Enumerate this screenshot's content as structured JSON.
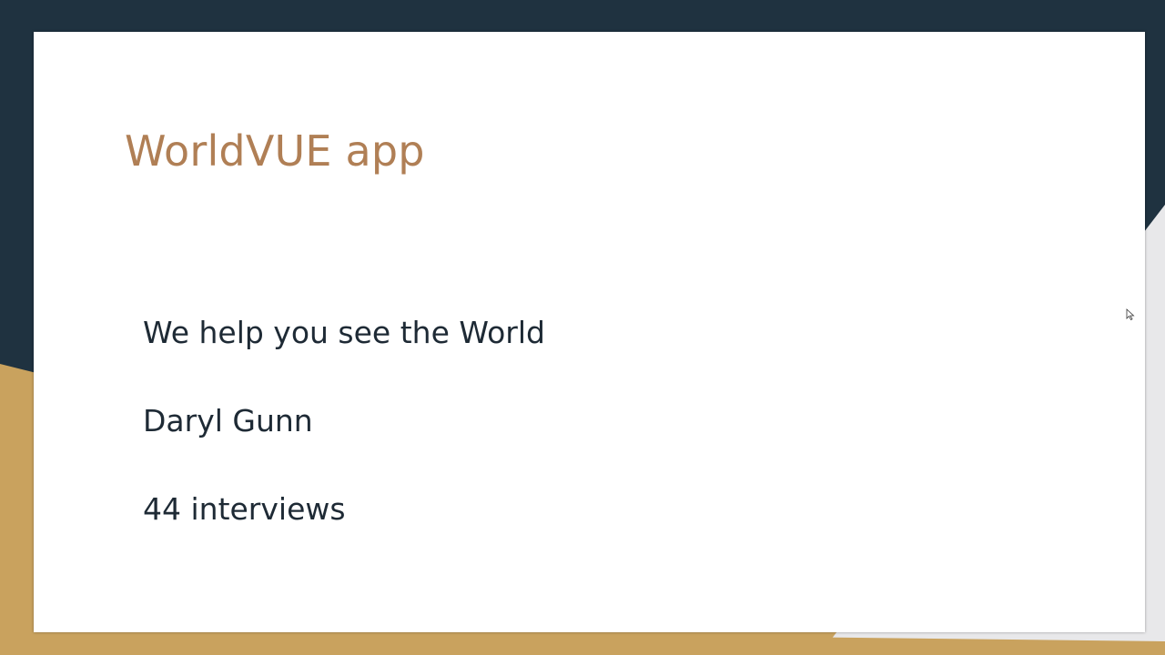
{
  "slide": {
    "title": "WorldVUE app",
    "lines": [
      "We help you see the World",
      "Daryl Gunn",
      "44 interviews"
    ]
  },
  "colors": {
    "background_navy": "#1f3240",
    "accent_gold": "#c9a25e",
    "title_color": "#b07f55",
    "body_text": "#1e2a35",
    "slide_bg": "#ffffff"
  },
  "icons": {
    "pointer": "mouse-pointer-icon"
  }
}
